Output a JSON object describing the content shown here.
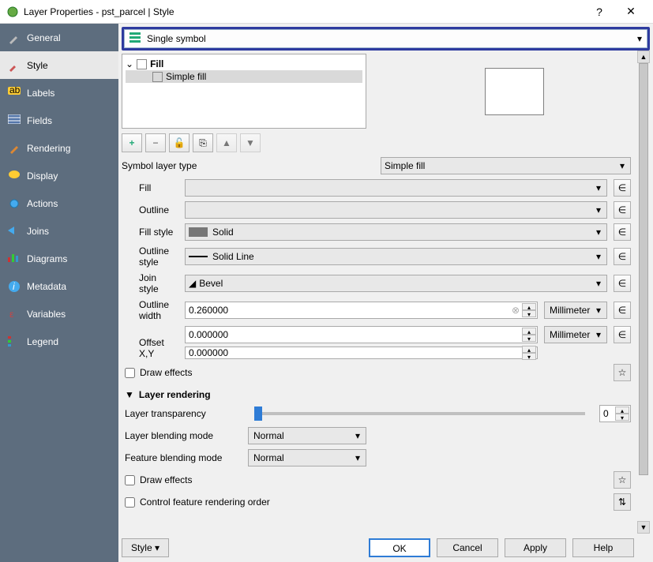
{
  "window": {
    "title": "Layer Properties - pst_parcel | Style"
  },
  "sidebar": {
    "tabs": [
      {
        "label": "General"
      },
      {
        "label": "Style"
      },
      {
        "label": "Labels"
      },
      {
        "label": "Fields"
      },
      {
        "label": "Rendering"
      },
      {
        "label": "Display"
      },
      {
        "label": "Actions"
      },
      {
        "label": "Joins"
      },
      {
        "label": "Diagrams"
      },
      {
        "label": "Metadata"
      },
      {
        "label": "Variables"
      },
      {
        "label": "Legend"
      }
    ],
    "active": 1
  },
  "renderer_dropdown": {
    "label": "Single symbol"
  },
  "symbol_tree": {
    "root": {
      "label": "Fill"
    },
    "child": {
      "label": "Simple fill"
    }
  },
  "symbol_layer_type": {
    "label": "Symbol layer type",
    "value": "Simple fill"
  },
  "fields": {
    "fill": {
      "label": "Fill"
    },
    "outline": {
      "label": "Outline"
    },
    "fill_style": {
      "label": "Fill style",
      "value": "Solid"
    },
    "outline_style": {
      "label": "Outline style",
      "value": "Solid Line"
    },
    "join_style": {
      "label": "Join style",
      "value": "Bevel"
    },
    "outline_width": {
      "label": "Outline width",
      "value": "0.260000",
      "unit": "Millimeter"
    },
    "offset": {
      "label": "Offset X,Y",
      "x": "0.000000",
      "y": "0.000000",
      "unit": "Millimeter"
    }
  },
  "draw_effects1": {
    "label": "Draw effects"
  },
  "layer_rendering": {
    "header": "Layer rendering"
  },
  "transparency": {
    "label": "Layer transparency",
    "value": "0"
  },
  "layer_blending": {
    "label": "Layer blending mode",
    "value": "Normal"
  },
  "feature_blending": {
    "label": "Feature blending mode",
    "value": "Normal"
  },
  "draw_effects2": {
    "label": "Draw effects"
  },
  "control_order": {
    "label": "Control feature rendering order"
  },
  "footer": {
    "style": "Style",
    "ok": "OK",
    "cancel": "Cancel",
    "apply": "Apply",
    "help": "Help"
  }
}
